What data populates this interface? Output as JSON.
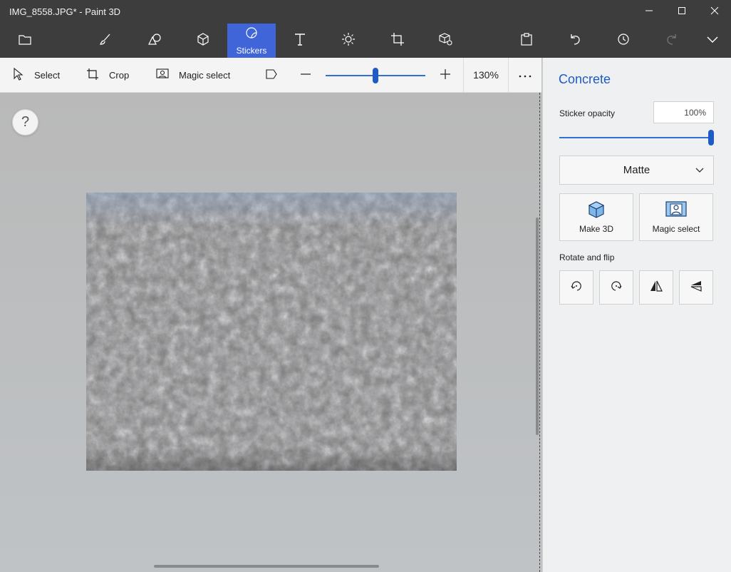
{
  "window": {
    "title": "IMG_8558.JPG* - Paint 3D",
    "controls": [
      "minimize-icon",
      "maximize-icon",
      "close-icon"
    ]
  },
  "ribbon": {
    "items": [
      {
        "id": "menu",
        "icon": "folder-icon",
        "label": ""
      },
      {
        "id": "brushes",
        "icon": "brush-icon",
        "label": ""
      },
      {
        "id": "2d-shapes",
        "icon": "shapes-2d-icon",
        "label": ""
      },
      {
        "id": "3d-shapes",
        "icon": "cube-icon",
        "label": ""
      },
      {
        "id": "stickers",
        "icon": "sticker-icon",
        "label": "Stickers",
        "active": true
      },
      {
        "id": "text",
        "icon": "text-icon",
        "label": ""
      },
      {
        "id": "effects",
        "icon": "sun-icon",
        "label": ""
      },
      {
        "id": "canvas",
        "icon": "canvas-icon",
        "label": ""
      },
      {
        "id": "3d-library",
        "icon": "library-icon",
        "label": ""
      },
      {
        "id": "paste",
        "icon": "paste-icon",
        "label": ""
      },
      {
        "id": "undo",
        "icon": "undo-icon",
        "label": ""
      },
      {
        "id": "history",
        "icon": "history-icon",
        "label": ""
      },
      {
        "id": "redo",
        "icon": "redo-icon",
        "label": ""
      },
      {
        "id": "expand",
        "icon": "chevron-down-icon",
        "label": ""
      }
    ],
    "active_color": "#3f65d8"
  },
  "toolbar": {
    "select_label": "Select",
    "crop_label": "Crop",
    "magic_select_label": "Magic select",
    "zoom_value": "130%",
    "more_icon": "ellipsis-icon"
  },
  "canvas": {
    "help_label": "?"
  },
  "panel": {
    "title": "Concrete",
    "sticker_opacity_label": "Sticker opacity",
    "sticker_opacity_value": "100%",
    "finish_value": "Matte",
    "make3d_label": "Make 3D",
    "magic_select_label": "Magic select",
    "rotate_flip_label": "Rotate and flip",
    "accent_color": "#1f5bc4"
  }
}
